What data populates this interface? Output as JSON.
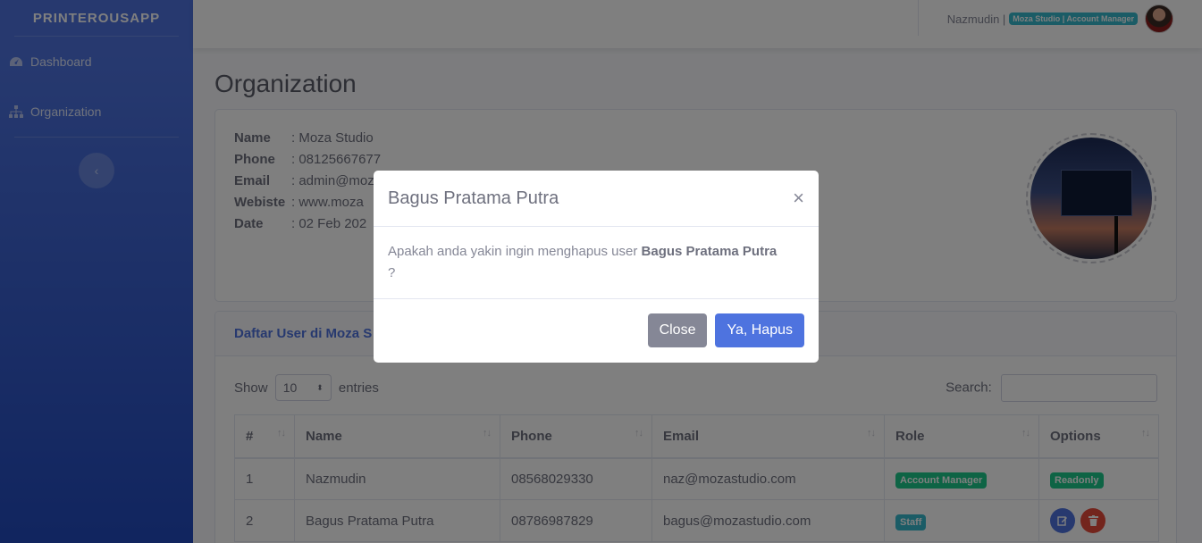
{
  "sidebar": {
    "brand": "PRINTEROUSAPP",
    "items": [
      {
        "label": "Dashboard",
        "icon": "gauge-icon"
      },
      {
        "label": "Organization",
        "icon": "sitemap-icon"
      }
    ],
    "toggle_glyph": "‹"
  },
  "topbar": {
    "user_name": "Nazmudin |",
    "role_badge": "Moza Studio | Account Manager"
  },
  "page": {
    "title": "Organization",
    "info": [
      {
        "key": "Name",
        "value": ": Moza Studio"
      },
      {
        "key": "Phone",
        "value": ": 08125667677"
      },
      {
        "key": "Email",
        "value": ": admin@moz"
      },
      {
        "key": "Webiste",
        "value": ": www.moza"
      },
      {
        "key": "Date",
        "value": ": 02 Feb 202"
      }
    ]
  },
  "user_list": {
    "title": "Daftar User di Moza S",
    "show_label": "Show",
    "show_value": "10",
    "entries_label": "entries",
    "search_label": "Search:",
    "columns": [
      "#",
      "Name",
      "Phone",
      "Email",
      "Role",
      "Options"
    ],
    "sort_glyph": "↑↓",
    "rows": [
      {
        "no": "1",
        "name": "Nazmudin",
        "phone": "08568029330",
        "email": "naz@mozastudio.com",
        "role": "Account Manager",
        "option": "Readonly"
      },
      {
        "no": "2",
        "name": "Bagus Pratama Putra",
        "phone": "08786987829",
        "email": "bagus@mozastudio.com",
        "role": "Staff",
        "option": ""
      }
    ]
  },
  "modal": {
    "title": "Bagus Pratama Putra",
    "close_glyph": "×",
    "body_text": "Apakah anda yakin ingin menghapus user ",
    "body_bold": "Bagus Pratama Putra",
    "body_tail": "?",
    "close_button": "Close",
    "confirm_button": "Ya, Hapus"
  },
  "colors": {
    "primary": "#4e73df",
    "success": "#1cc88a",
    "info": "#36b9cc",
    "danger": "#e74a3b",
    "secondary": "#858796"
  }
}
